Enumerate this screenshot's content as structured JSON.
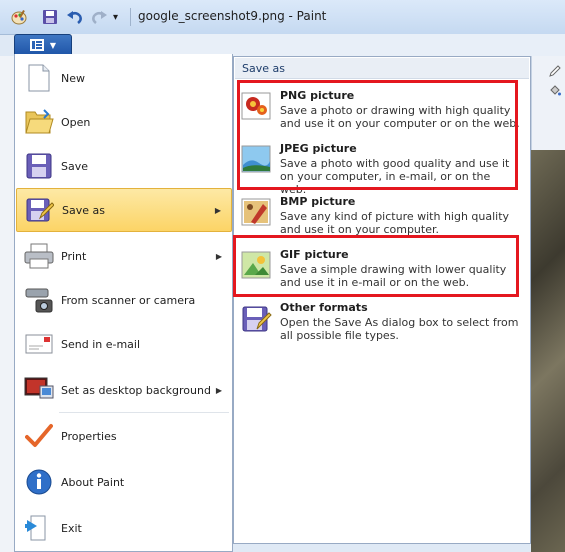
{
  "window": {
    "title": "google_screenshot9.png - Paint",
    "qat_dropdown": "▾"
  },
  "menu": {
    "items": [
      {
        "label": "New",
        "icon": "new-document-icon",
        "arrow": ""
      },
      {
        "label": "Open",
        "icon": "open-folder-icon",
        "arrow": ""
      },
      {
        "label": "Save",
        "icon": "save-disk-icon",
        "arrow": ""
      },
      {
        "label": "Save as",
        "icon": "save-as-icon",
        "arrow": "▶"
      },
      {
        "label": "Print",
        "icon": "printer-icon",
        "arrow": "▶"
      },
      {
        "label": "From scanner or camera",
        "icon": "scanner-icon",
        "arrow": ""
      },
      {
        "label": "Send in e-mail",
        "icon": "email-icon",
        "arrow": ""
      },
      {
        "label": "Set as desktop background",
        "icon": "desktop-icon",
        "arrow": "▶"
      },
      {
        "label": "Properties",
        "icon": "checkmark-icon",
        "arrow": ""
      },
      {
        "label": "About Paint",
        "icon": "info-icon",
        "arrow": ""
      },
      {
        "label": "Exit",
        "icon": "exit-icon",
        "arrow": ""
      }
    ]
  },
  "saveas": {
    "header": "Save as",
    "options": [
      {
        "title": "PNG picture",
        "desc": "Save a photo or drawing with high quality and use it on your computer or on the web.",
        "icon": "png-picture-icon"
      },
      {
        "title": "JPEG picture",
        "desc": "Save a photo with good quality and use it on your computer, in e-mail, or on the web.",
        "icon": "jpeg-picture-icon"
      },
      {
        "title": "BMP picture",
        "desc": "Save any kind of picture with high quality and use it on your computer.",
        "icon": "bmp-picture-icon"
      },
      {
        "title": "GIF picture",
        "desc": "Save a simple drawing with lower quality and use it in e-mail or on the web.",
        "icon": "gif-picture-icon"
      },
      {
        "title": "Other formats",
        "desc": "Open the Save As dialog box to select from all possible file types.",
        "icon": "other-formats-icon"
      }
    ]
  },
  "colors": {
    "highlight": "#fcd466",
    "annotation_red": "#e4171f",
    "menu_button": "#2b63b5"
  }
}
